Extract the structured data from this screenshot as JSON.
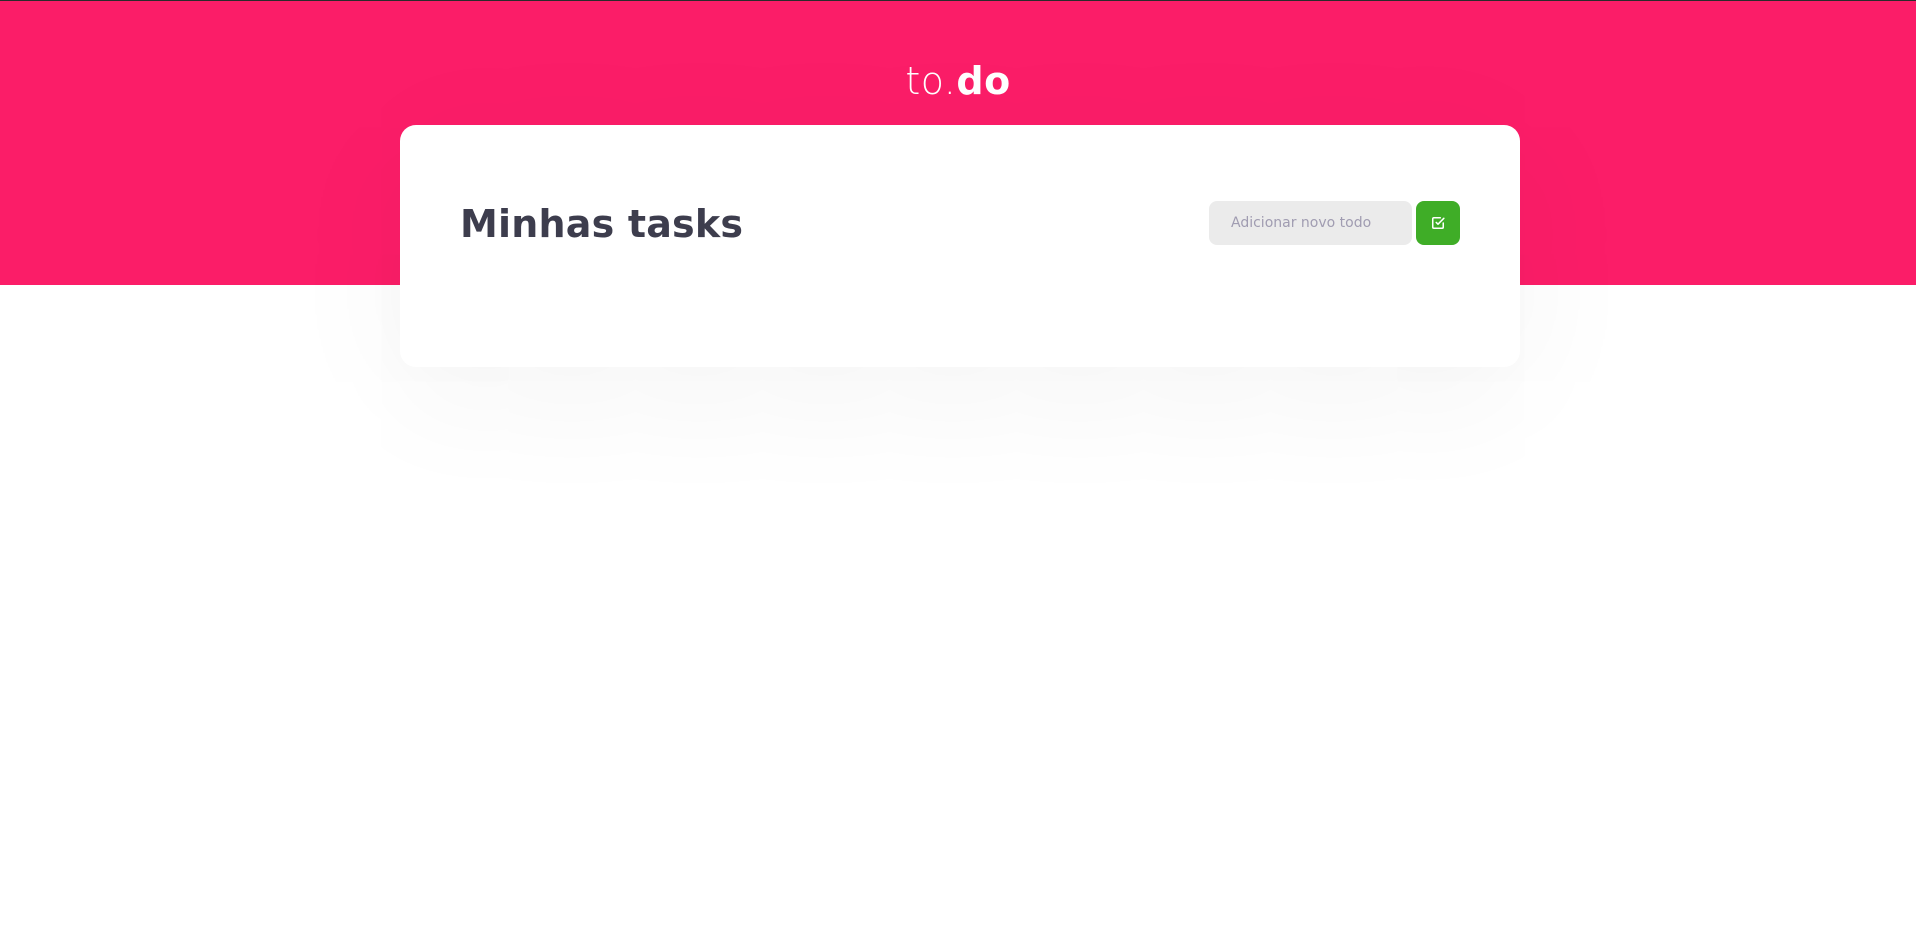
{
  "header": {
    "logo_prefix": "to.",
    "logo_suffix": "do",
    "background_color": "#fb1d68"
  },
  "card": {
    "title": "Minhas tasks",
    "new_todo": {
      "value": "",
      "placeholder": "Adicionar novo todo"
    },
    "add_button": {
      "icon": "check-square-icon",
      "color": "#3fad27"
    }
  }
}
